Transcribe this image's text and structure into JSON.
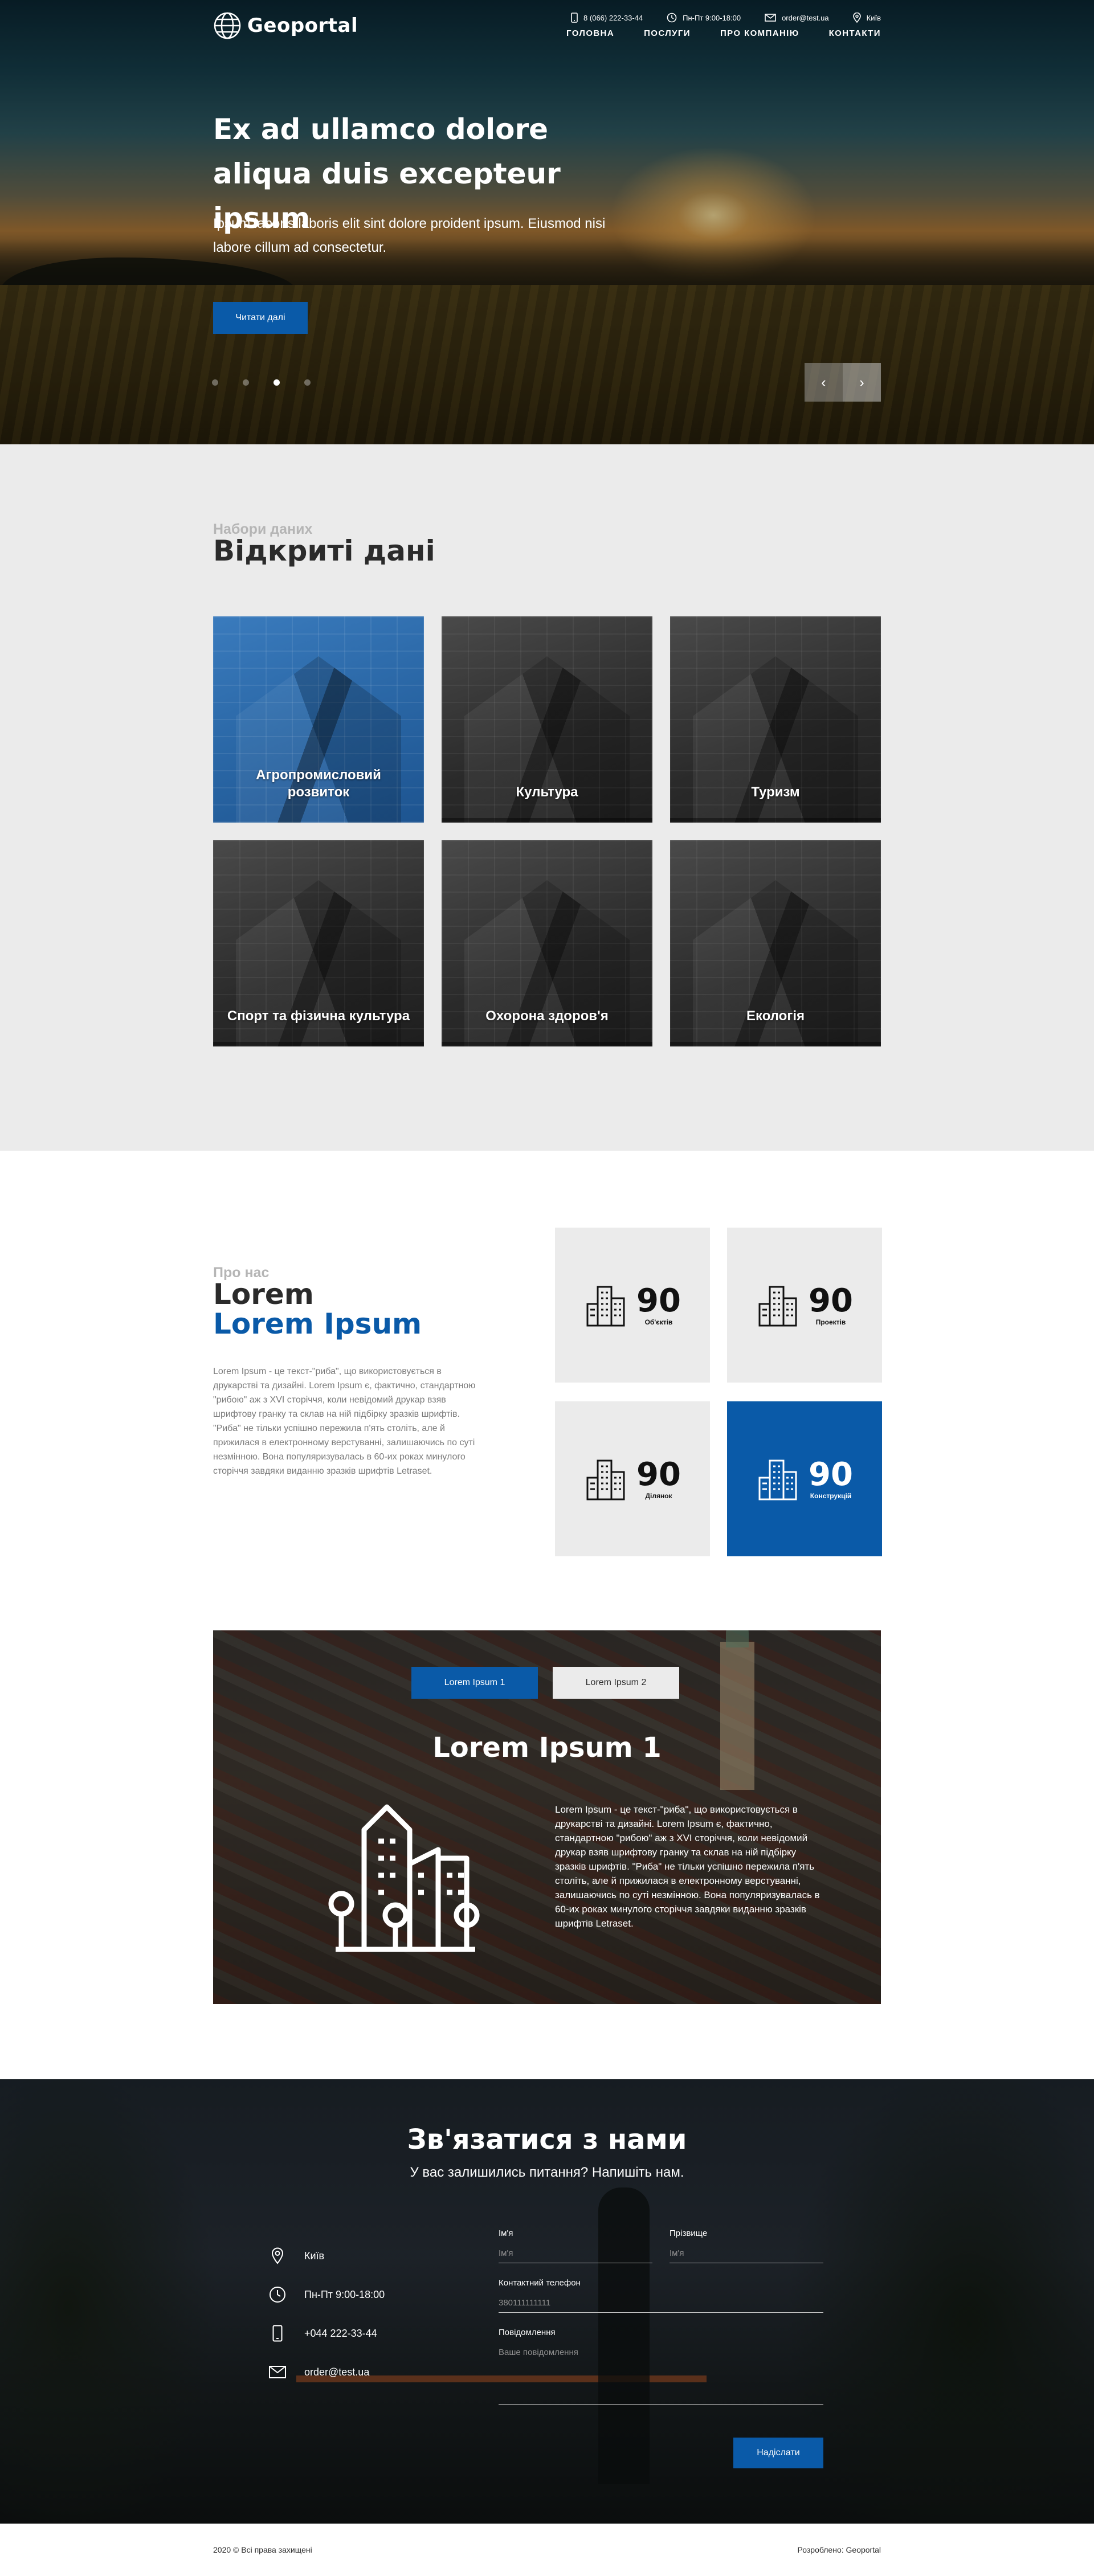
{
  "header": {
    "brand": "Geoportal",
    "contacts": {
      "phone": "8 (066) 222-33-44",
      "hours": "Пн-Пт 9:00-18:00",
      "email": "order@test.ua",
      "city": "Київ"
    },
    "nav": [
      "ГОЛОВНА",
      "ПОСЛУГИ",
      "ПРО КОМПАНІЮ",
      "КОНТАКТИ"
    ]
  },
  "hero": {
    "title": "Ex ad ullamco dolore aliqua duis excepteur ipsum",
    "subtitle": "Ipsum laboris laboris elit sint dolore proident ipsum. Eiusmod nisi labore cillum ad consectetur.",
    "button": "Читати далі",
    "slides_total": 4,
    "active_slide": 3,
    "prev_icon": "‹",
    "next_icon": "›"
  },
  "datasets": {
    "eyebrow": "Набори даних",
    "title": "Відкриті дані",
    "items": [
      "Агропромисловий розвиток",
      "Культура",
      "Туризм",
      "Спорт та фізична культура",
      "Охорона здоров'я",
      "Екологія"
    ]
  },
  "about": {
    "eyebrow": "Про нас",
    "title_line1": "Lorem",
    "title_line2": "Lorem Ipsum",
    "text": "Lorem Ipsum - це текст-\"риба\", що використовується в друкарстві та дизайні. Lorem Ipsum є, фактично, стандартною \"рибою\" аж з XVI сторіччя, коли невідомий друкар взяв шрифтову гранку та склав на ній підбірку зразків шрифтів. \"Риба\" не тільки успішно пережила п'ять століть, але й прижилася в електронному верстуванні, залишаючись по суті незмінною. Вона популяризувалась в 60-их роках минулого сторіччя завдяки виданню зразків шрифтів Letraset.",
    "stats": [
      {
        "value": "90",
        "label": "Об'єктів"
      },
      {
        "value": "90",
        "label": "Проектів"
      },
      {
        "value": "90",
        "label": "Ділянок"
      },
      {
        "value": "90",
        "label": "Конструкцій"
      }
    ]
  },
  "tabs": {
    "items": [
      "Lorem Ipsum 1",
      "Lorem Ipsum 2"
    ],
    "active": 0,
    "title": "Lorem Ipsum 1",
    "text": "Lorem Ipsum - це текст-\"риба\", що використовується в друкарстві та дизайні. Lorem Ipsum є, фактично, стандартною \"рибою\" аж з XVI сторіччя, коли невідомий друкар взяв шрифтову гранку та склав на ній підбірку зразків шрифтів. \"Риба\" не тільки успішно пережила п'ять століть, але й прижилася в електронному верстуванні, залишаючись по суті незмінною. Вона популяризувалась в 60-их роках минулого сторіччя завдяки виданню зразків шрифтів Letraset."
  },
  "contact": {
    "title": "Зв'язатися з нами",
    "subtitle": "У вас залишились питання? Напишіть нам.",
    "info": {
      "city": "Київ",
      "hours": "Пн-Пт 9:00-18:00",
      "phone": "+044 222-33-44",
      "email": "order@test.ua"
    },
    "form": {
      "name_label": "Ім'я",
      "name_placeholder": "Ім'я",
      "surname_label": "Прізвище",
      "surname_placeholder": "Ім'я",
      "phone_label": "Контактний телефон",
      "phone_placeholder": "380111111111",
      "message_label": "Повідомлення",
      "message_placeholder": "Ваше повідомлення",
      "submit": "Надіслати"
    }
  },
  "footer": {
    "copyright": "2020 © Всі права захищені",
    "credit": "Розроблено: Geoportal"
  },
  "colors": {
    "accent": "#0a5aa8",
    "section_gray": "#ebebeb",
    "text_dark": "#2b2b2b",
    "muted": "#b5b5b5"
  }
}
